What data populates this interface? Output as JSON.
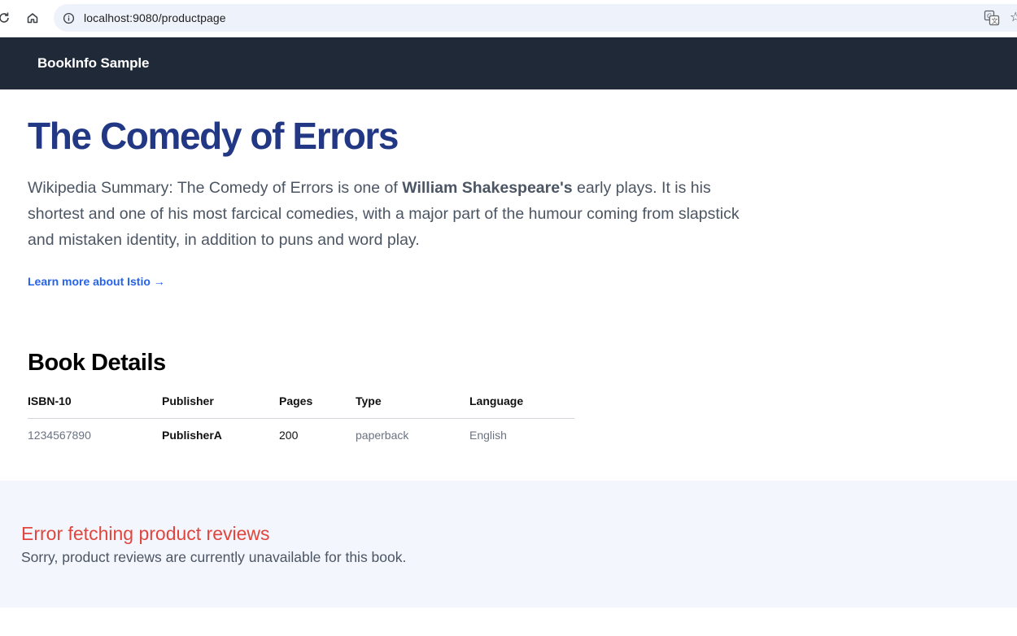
{
  "browser": {
    "url": "localhost:9080/productpage"
  },
  "navbar": {
    "brand": "BookInfo Sample"
  },
  "product": {
    "title": "The Comedy of Errors",
    "summary_prefix": "Wikipedia Summary: The Comedy of Errors is one of ",
    "summary_bold": "William Shakespeare's",
    "summary_suffix": " early plays. It is his shortest and one of his most farcical comedies, with a major part of the humour coming from slapstick and mistaken identity, in addition to puns and word play.",
    "learn_more": "Learn more about Istio →"
  },
  "details": {
    "heading": "Book Details",
    "columns": [
      "ISBN-10",
      "Publisher",
      "Pages",
      "Type",
      "Language"
    ],
    "row": [
      "1234567890",
      "PublisherA",
      "200",
      "paperback",
      "English"
    ]
  },
  "reviews": {
    "error_title": "Error fetching product reviews",
    "error_message": "Sorry, product reviews are currently unavailable for this book."
  },
  "colors": {
    "navbar_bg": "#1f2937",
    "title": "#233885",
    "link": "#2563eb",
    "error": "#e0463d",
    "reviews_bg": "#f3f6fd"
  }
}
